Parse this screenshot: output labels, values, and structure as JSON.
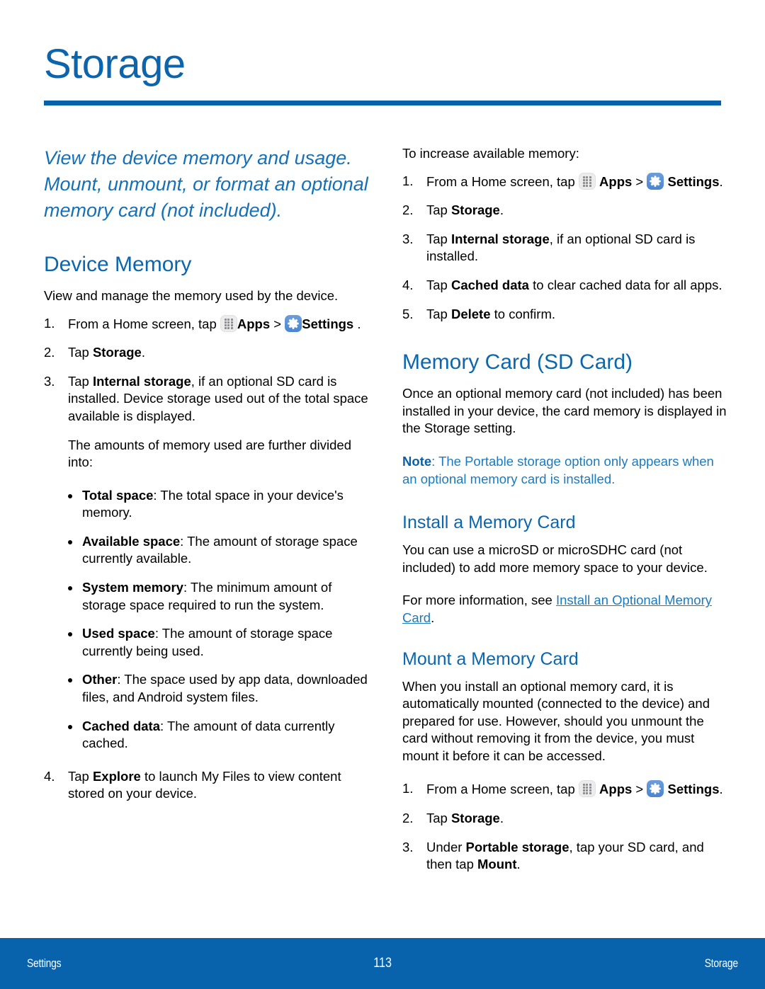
{
  "page": {
    "title": "Storage",
    "accent_blue": "#0863ac",
    "heading_blue": "#0b66ad",
    "note_blue": "#1b7ac0"
  },
  "intro": "View the device memory and usage. Mount, unmount, or format an optional memory card (not included).",
  "icons": {
    "apps_label": "Apps",
    "settings_label": "Settings",
    "apps_icon": "apps-grid-icon",
    "settings_icon": "gear-icon"
  },
  "left_column": {
    "section_title": "Device Memory",
    "intro_text": "View and manage the memory used by the device.",
    "steps": {
      "s1_pre": "From a Home screen, tap ",
      "s1_apps": "Apps",
      "s1_mid": " > ",
      "s1_settings": "Settings",
      "s1_post": " .",
      "s2_pre": "Tap ",
      "s2_bold": "Storage",
      "s2_post": ".",
      "s3_pre": "Tap ",
      "s3_bold": "Internal storage",
      "s3_post": ", if an optional SD card is installed. Device storage used out of the total space available is displayed.",
      "s3_extra": "The amounts of memory used are further divided into:",
      "s4_pre": "Tap ",
      "s4_bold": "Explore",
      "s4_post": " to launch My Files to view content stored on your device."
    },
    "bullets": [
      {
        "term": "Total space",
        "desc": ": The total space in your device's memory."
      },
      {
        "term": "Available space",
        "desc": ": The amount of storage space currently available."
      },
      {
        "term": "System memory",
        "desc": ": The minimum amount of storage space required to run the system."
      },
      {
        "term": "Used space",
        "desc": ": The amount of storage space currently being used."
      },
      {
        "term": "Other",
        "desc": ": The space used by app data, downloaded files, and Android system files."
      },
      {
        "term": "Cached data",
        "desc": ": The amount of data currently cached."
      }
    ]
  },
  "right_column": {
    "increase_intro": "To increase available memory:",
    "increase_steps": {
      "s1_pre": "From a Home screen, tap ",
      "s1_apps": "Apps",
      "s1_mid": " > ",
      "s1_settings": "Settings",
      "s1_post": ".",
      "s2_pre": "Tap ",
      "s2_bold": "Storage",
      "s2_post": ".",
      "s3_pre": "Tap ",
      "s3_bold": "Internal storage",
      "s3_post": ", if an optional SD card is installed.",
      "s4_pre": "Tap ",
      "s4_bold": "Cached data",
      "s4_post": " to clear cached data for all apps.",
      "s5_pre": "Tap ",
      "s5_bold": "Delete",
      "s5_post": " to confirm."
    },
    "memory_card": {
      "section_title": "Memory Card (SD Card)",
      "body": "Once an optional memory card (not included) has been installed in your device, the card memory is displayed in the Storage setting.",
      "note_label": "Note",
      "note_text": ": The Portable storage option only appears when an optional memory card is installed."
    },
    "install": {
      "subsection_title": "Install a Memory Card",
      "body": "You can use a microSD or microSDHC card (not included) to add more memory space to your device.",
      "more_info_pre": "For more information, see ",
      "more_info_link": "Install an Optional Memory Card",
      "more_info_post": "."
    },
    "mount": {
      "subsection_title": "Mount a Memory Card",
      "body": "When you install an optional memory card, it is automatically mounted (connected to the device) and prepared for use. However, should you unmount the card without removing it from the device, you must mount it before it can be accessed.",
      "steps": {
        "s1_pre": "From a Home screen, tap ",
        "s1_apps": "Apps",
        "s1_mid": " > ",
        "s1_settings": "Settings",
        "s1_post": ".",
        "s2_pre": "Tap ",
        "s2_bold": "Storage",
        "s2_post": ".",
        "s3_pre": "Under ",
        "s3_bold": "Portable storage",
        "s3_mid": ", tap your SD card, and then tap ",
        "s3_bold2": "Mount",
        "s3_post": "."
      }
    }
  },
  "footer": {
    "left": "Settings",
    "page_number": "113",
    "right": "Storage"
  }
}
